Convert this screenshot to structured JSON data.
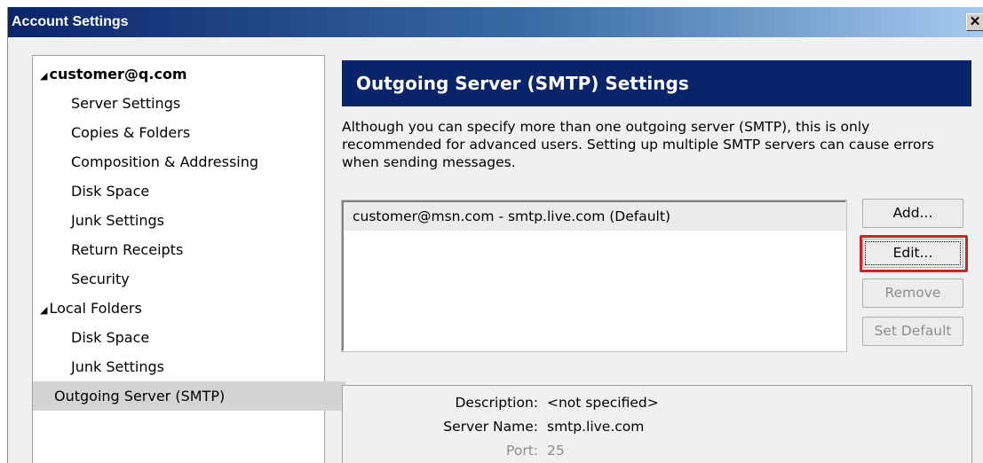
{
  "window": {
    "title": "Account Settings",
    "close_glyph": "✕"
  },
  "tree": {
    "items": [
      {
        "label": "customer@q.com",
        "level": "root",
        "expanded": true
      },
      {
        "label": "Server Settings"
      },
      {
        "label": "Copies & Folders"
      },
      {
        "label": "Composition & Addressing"
      },
      {
        "label": "Disk Space"
      },
      {
        "label": "Junk Settings"
      },
      {
        "label": "Return Receipts"
      },
      {
        "label": "Security"
      },
      {
        "label": "Local Folders",
        "level": "root",
        "expanded": true
      },
      {
        "label": "Disk Space"
      },
      {
        "label": "Junk Settings"
      },
      {
        "label": "Outgoing Server (SMTP)",
        "selected": true
      }
    ],
    "expand_glyph": "◢"
  },
  "main": {
    "header": "Outgoing Server (SMTP) Settings",
    "description": "Although you can specify more than one outgoing server (SMTP), this is only recommended for advanced users. Setting up multiple SMTP servers can cause errors when sending messages.",
    "servers": [
      "customer@msn.com - smtp.live.com (Default)"
    ],
    "buttons": {
      "add": "Add...",
      "edit": "Edit...",
      "remove": "Remove",
      "set_default": "Set Default"
    },
    "details": {
      "description_label": "Description:",
      "description_value": "<not specified>",
      "server_name_label": "Server Name:",
      "server_name_value": "smtp.live.com",
      "port_label": "Port:",
      "port_value": "25"
    }
  },
  "colors": {
    "header_bg": "#0a246a",
    "highlight_border": "#c0292b",
    "selected_bg": "#d4d4d4"
  }
}
